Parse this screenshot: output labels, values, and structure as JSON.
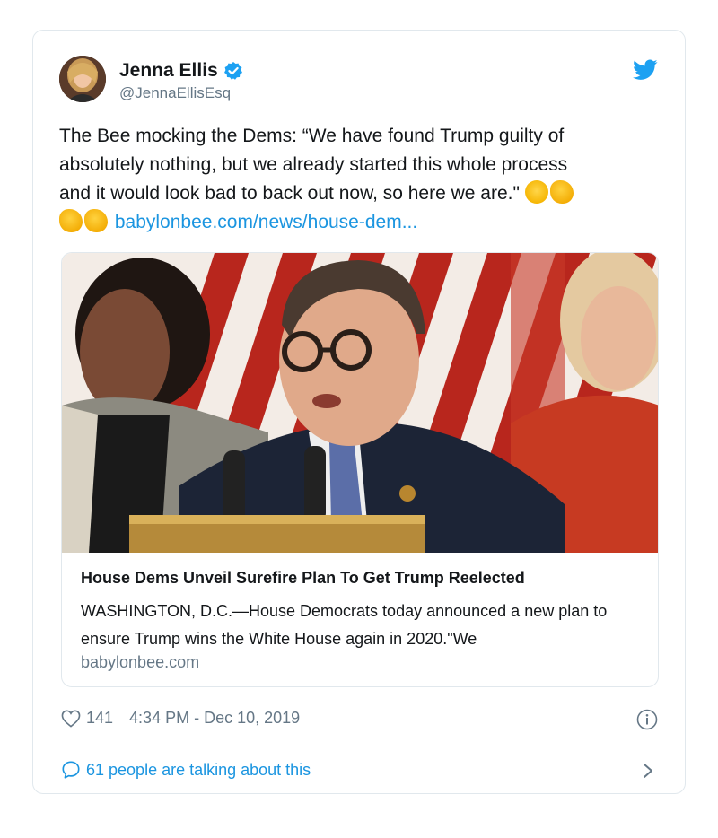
{
  "author": {
    "name": "Jenna Ellis",
    "handle": "@JennaEllisEsq"
  },
  "tweet": {
    "text_lines": [
      "The Bee mocking the Dems: “We have found Trump guilty of",
      "absolutely nothing, but we already started this whole process",
      "and it would look bad to back out now, so here we are.\""
    ],
    "link_text": "babylonbee.com/news/house-dem..."
  },
  "link_card": {
    "title": "House Dems Unveil Surefire Plan To Get Trump Reelected",
    "description": "WASHINGTON, D.C.—House Democrats today announced a new plan to ensure Trump wins the White House again in 2020.\"We",
    "domain": "babylonbee.com"
  },
  "meta": {
    "likes": "141",
    "timestamp": "4:34 PM - Dec 10, 2019"
  },
  "conversation": {
    "label": "61 people are talking about this"
  },
  "colors": {
    "twitter_blue": "#1da1f2",
    "link": "#1b95e0",
    "muted": "#657786",
    "border": "#e1e8ed"
  },
  "icons": [
    "verified-badge-icon",
    "twitter-bird-icon",
    "heart-icon",
    "info-icon",
    "reply-bubble-icon",
    "chevron-right-icon"
  ]
}
